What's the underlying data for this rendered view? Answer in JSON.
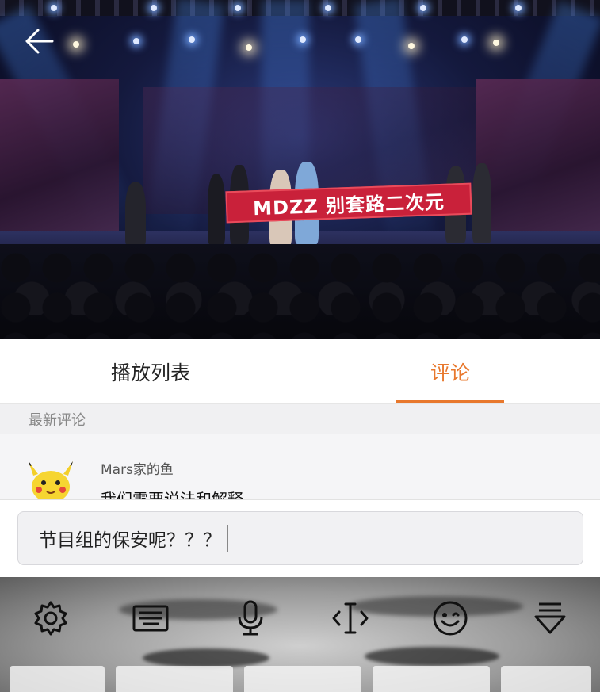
{
  "video": {
    "banner_text": "MDZZ 别套路二次元"
  },
  "tabs": [
    {
      "label": "播放列表",
      "active": false
    },
    {
      "label": "评论",
      "active": true
    }
  ],
  "comments": {
    "section_title": "最新评论",
    "items": [
      {
        "user": "Mars家的鱼",
        "text": "我们需要说法和解释"
      }
    ]
  },
  "input": {
    "value": "节目组的保安呢？？？"
  },
  "keyboard": {
    "toolbar": [
      "gear-icon",
      "keyboard-icon",
      "microphone-icon",
      "cursor-icon",
      "emoji-icon",
      "collapse-icon"
    ]
  },
  "colors": {
    "accent": "#e8782d",
    "banner": "#c9213a"
  }
}
